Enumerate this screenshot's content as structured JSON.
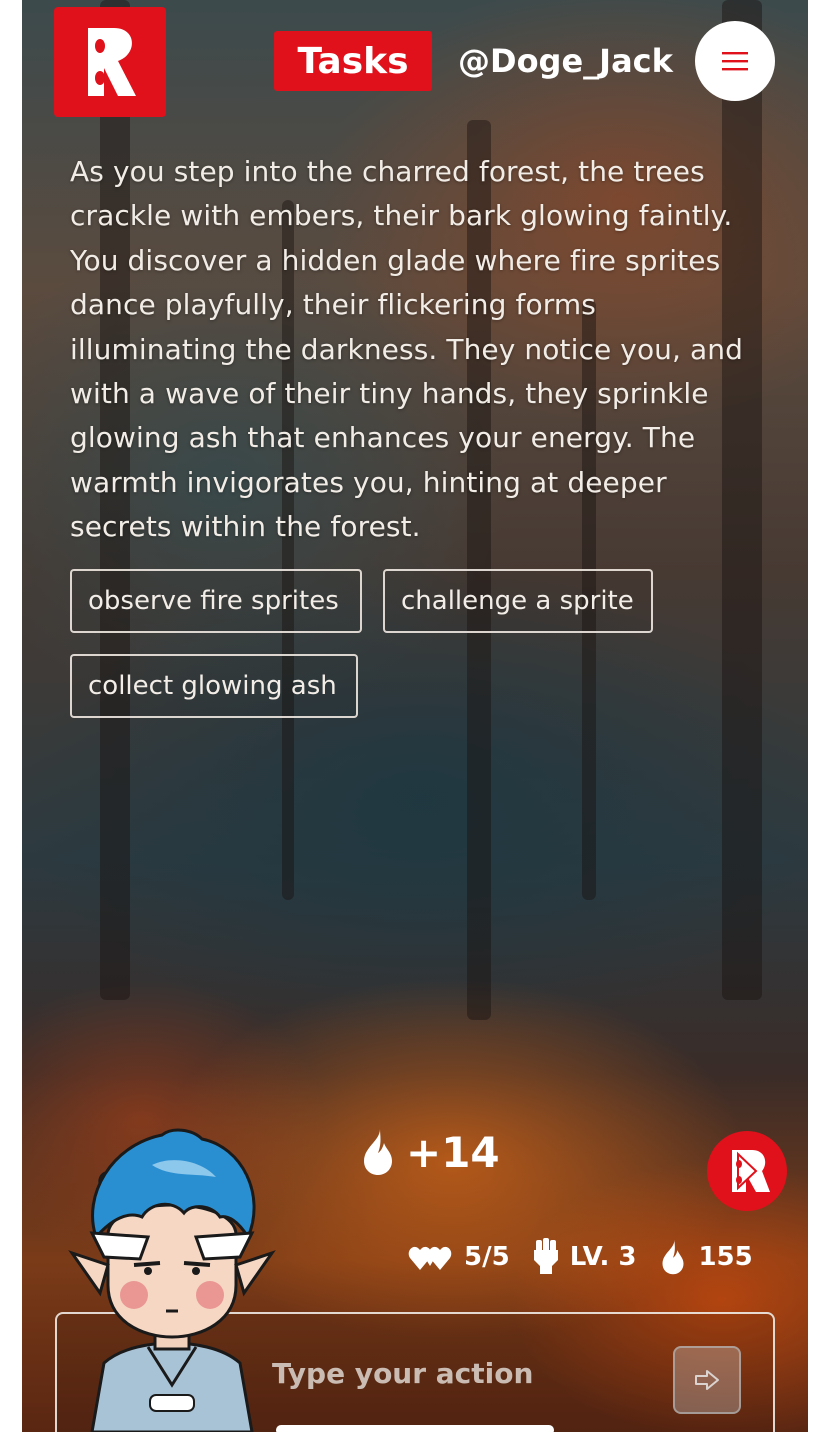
{
  "header": {
    "logo_letter": "R",
    "tasks_label": "Tasks",
    "username": "@Doge_Jack",
    "brand_color": "#e0111b"
  },
  "story": {
    "text": "As you step into the charred forest, the trees crackle with embers, their bark glowing faintly. You discover a hidden glade where fire sprites dance playfully, their flickering forms illuminating the darkness. They notice you, and with a wave of their tiny hands, they sprinkle glowing ash that enhances your energy. The warmth invigorates you, hinting at deeper secrets within the forest."
  },
  "choices": [
    {
      "label": "observe fire sprites"
    },
    {
      "label": "challenge a sprite"
    },
    {
      "label": "collect glowing ash"
    }
  ],
  "reward": {
    "icon": "flame-icon",
    "value": "+14"
  },
  "stats": {
    "health": {
      "icon": "hearts-icon",
      "value": "5/5"
    },
    "level": {
      "icon": "fist-icon",
      "value": "LV. 3"
    },
    "energy": {
      "icon": "flame-icon",
      "value": "155"
    }
  },
  "input": {
    "placeholder": "Type your action",
    "value": ""
  }
}
